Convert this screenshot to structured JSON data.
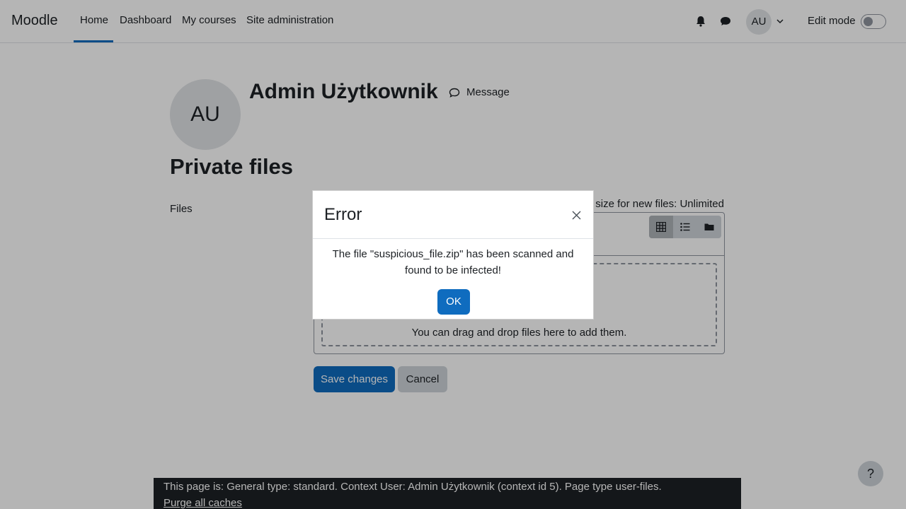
{
  "navbar": {
    "brand": "Moodle",
    "items": [
      "Home",
      "Dashboard",
      "My courses",
      "Site administration"
    ],
    "user_initials": "AU",
    "edit_mode_label": "Edit mode",
    "icons": [
      "bell-icon",
      "chat-icon",
      "chevron-down-icon"
    ]
  },
  "profile": {
    "initials": "AU",
    "name": "Admin Użytkownik",
    "message_label": "Message"
  },
  "page": {
    "title": "Private files",
    "files_label": "Files",
    "max_size": "size for new files: Unlimited",
    "dropzone_text": "You can drag and drop files here to add them.",
    "save_label": "Save changes",
    "cancel_label": "Cancel",
    "view_icons": [
      "grid-icon",
      "list-icon",
      "folder-icon"
    ]
  },
  "footer": {
    "text": "This page is: General type: standard. Context User: Admin Użytkownik (context id 5). Page type user-files.",
    "link": "Purge all caches",
    "help": "?"
  },
  "modal": {
    "title": "Error",
    "body": "The file \"suspicious_file.zip\" has been scanned and found to be infected!",
    "ok_label": "OK"
  },
  "colors": {
    "primary": "#0f6cbf",
    "footer_bg": "#1d2125",
    "backdrop": "rgba(0,0,0,0.29)"
  }
}
